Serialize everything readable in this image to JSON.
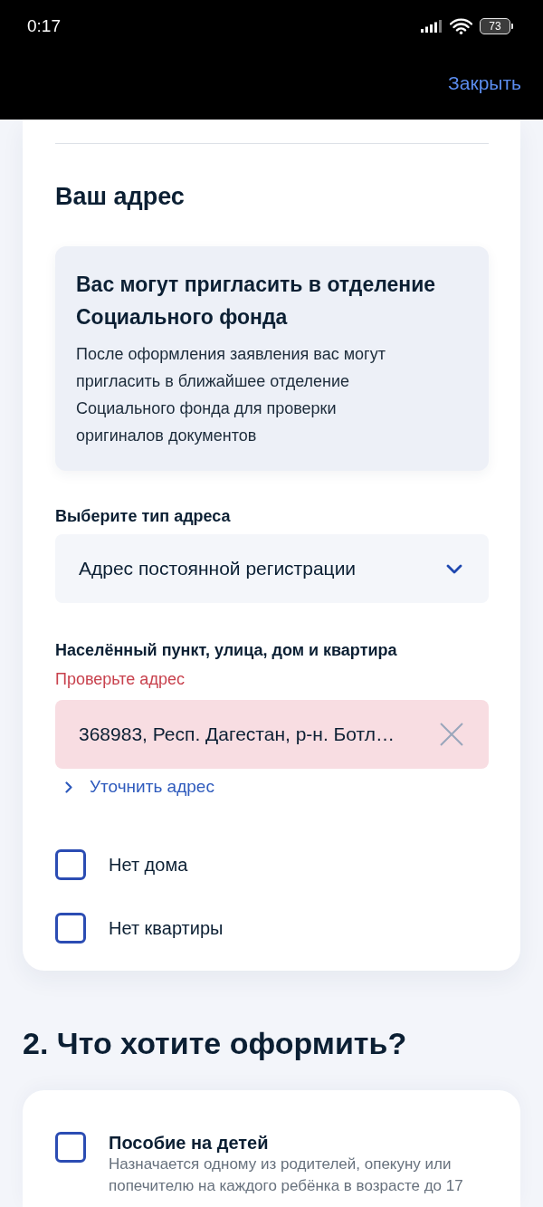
{
  "status_bar": {
    "time": "0:17",
    "battery": "73"
  },
  "header": {
    "close_label": "Закрыть"
  },
  "address_section": {
    "title": "Ваш адрес",
    "notice": {
      "title": "Вас могут пригласить в отделение Социального фонда",
      "text": "После оформления заявления вас могут пригласить в ближайшее отделение Социального фонда для проверки оригиналов документов"
    },
    "address_type": {
      "label": "Выберите тип адреса",
      "value": "Адрес постоянной регистрации"
    },
    "address": {
      "label": "Населённый пункт, улица, дом и квартира",
      "error": "Проверьте адрес",
      "value": "368983, Респ. Дагестан, р-н. Ботл…",
      "clarify_link": "Уточнить адрес"
    },
    "options": [
      {
        "label": "Нет дома",
        "checked": false
      },
      {
        "label": "Нет квартиры",
        "checked": false
      }
    ]
  },
  "section_2": {
    "title": "2. Что хотите оформить?",
    "options": [
      {
        "label": "Пособие на детей",
        "description": "Назначается одному из родителей, опекуну или попечителю на каждого ребёнка в возрасте до 17",
        "checked": false
      }
    ]
  }
}
